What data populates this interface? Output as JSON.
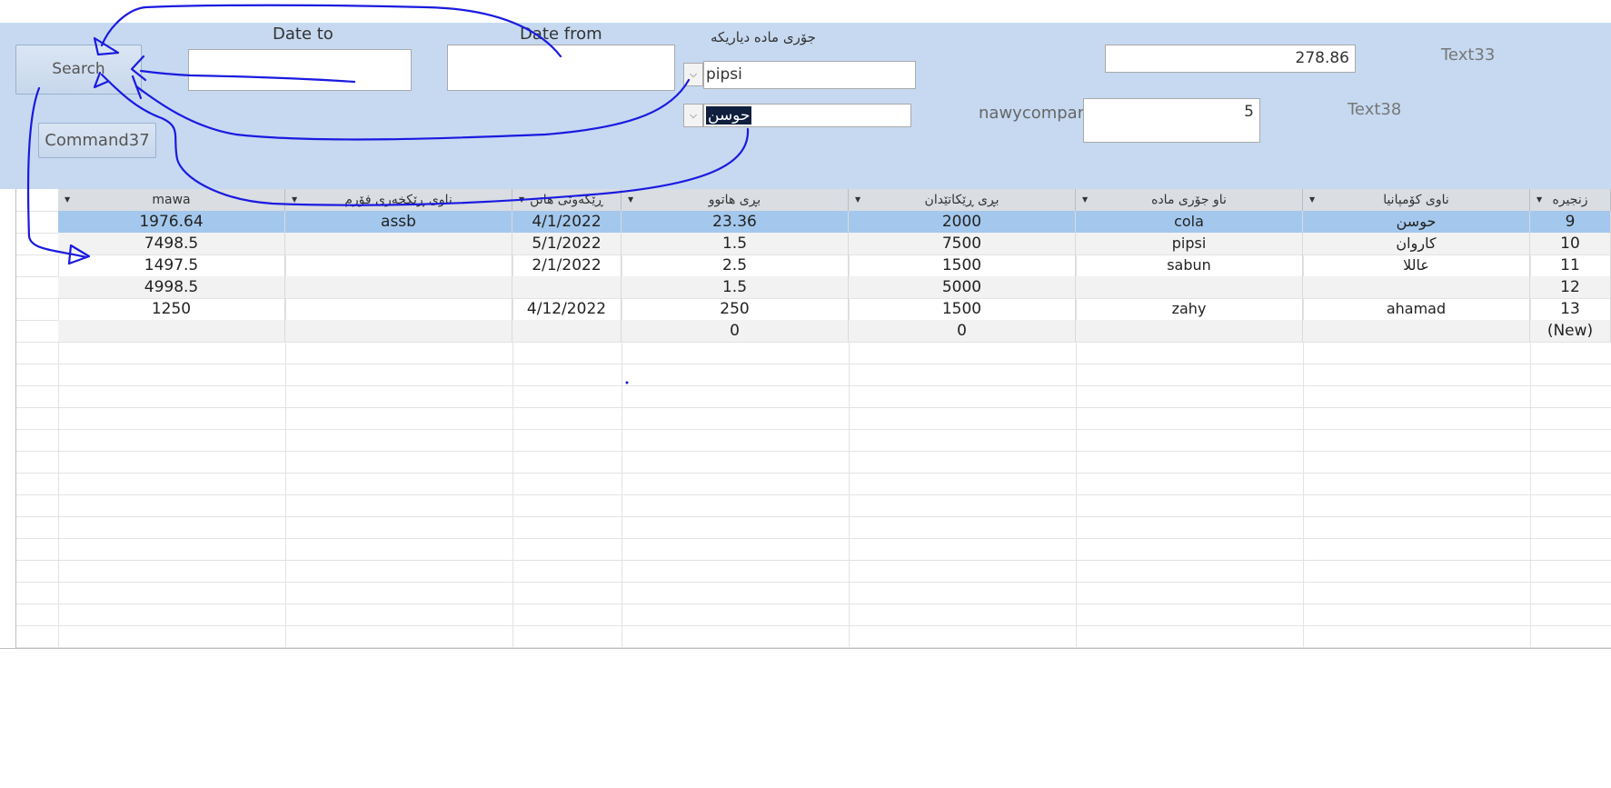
{
  "form": {
    "search_label": "Search",
    "command37_label": "Command37",
    "date_to_label": "Date to",
    "date_from_label": "Date from",
    "date_to_value": "",
    "date_from_value": "",
    "material_type_label": "جۆری مادە دیاریکە",
    "material_combo_value": "pipsi",
    "company_combo_value": "حوسن",
    "nawycompany_label": "nawycompanyy",
    "nawycompany_value": "5",
    "text33_label": "Text33",
    "text33_value": "278.86",
    "text38_label": "Text38"
  },
  "table": {
    "columns": [
      "mawa",
      "ناوی ڕێکخەری فۆرم",
      "ڕێکەوتی هاتن",
      "بڕی هاتوو",
      "بڕی ڕێکاتێدان",
      "ناو جۆری مادە",
      "ناوی کۆمپانیا",
      "زنجیرە"
    ],
    "rows": [
      {
        "mawa": "1976.64",
        "form_maker": "assb",
        "date": "4/1/2022",
        "qty_in": "23.36",
        "qty_given": "2000",
        "material": "cola",
        "company": "حوسن",
        "id": "9"
      },
      {
        "mawa": "7498.5",
        "form_maker": "",
        "date": "5/1/2022",
        "qty_in": "1.5",
        "qty_given": "7500",
        "material": "pipsi",
        "company": "کاروان",
        "id": "10"
      },
      {
        "mawa": "1497.5",
        "form_maker": "",
        "date": "2/1/2022",
        "qty_in": "2.5",
        "qty_given": "1500",
        "material": "sabun",
        "company": "عاللا",
        "id": "11"
      },
      {
        "mawa": "4998.5",
        "form_maker": "",
        "date": "",
        "qty_in": "1.5",
        "qty_given": "5000",
        "material": "",
        "company": "",
        "id": "12"
      },
      {
        "mawa": "1250",
        "form_maker": "",
        "date": "4/12/2022",
        "qty_in": "250",
        "qty_given": "1500",
        "material": "zahy",
        "company": "ahamad",
        "id": "13"
      },
      {
        "mawa": "",
        "form_maker": "",
        "date": "",
        "qty_in": "0",
        "qty_given": "0",
        "material": "",
        "company": "",
        "id": "(New)"
      }
    ]
  },
  "colors": {
    "band": "#c6d9f1",
    "selected_row": "#a4c8ed",
    "alt_row": "#f2f2f2",
    "annotation_ink": "#1a1ae0"
  }
}
